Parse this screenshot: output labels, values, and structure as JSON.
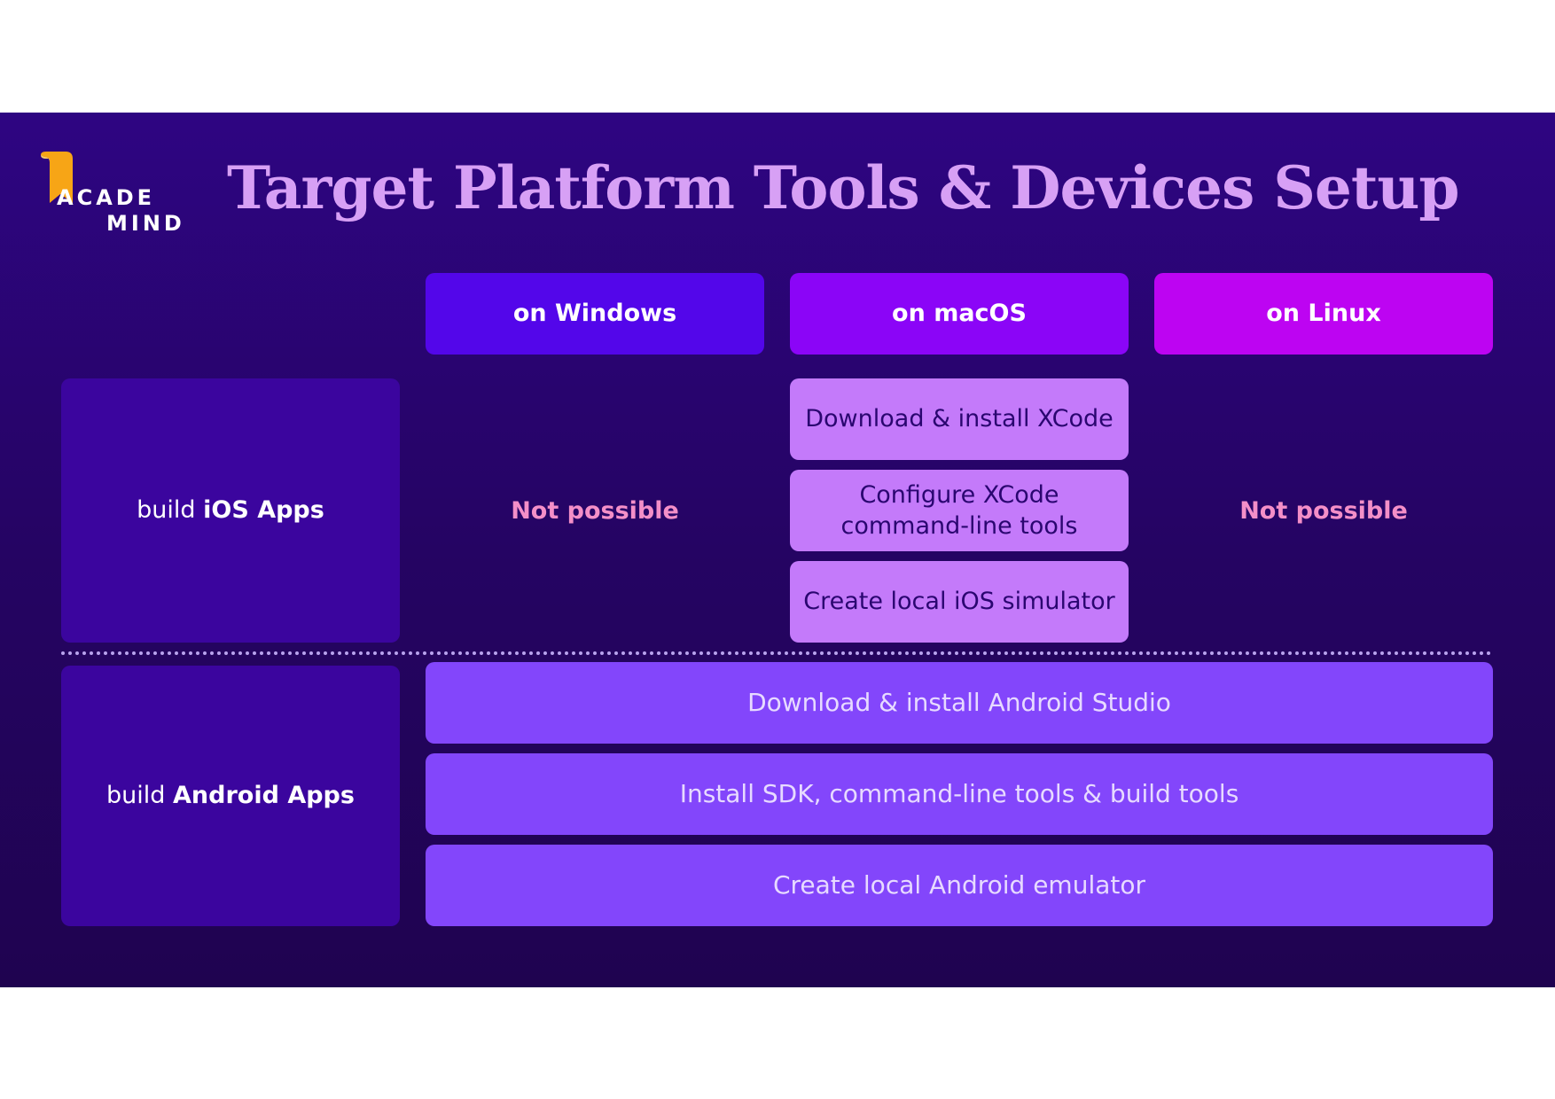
{
  "logo": {
    "line1": "ACADE",
    "line2": "MIND",
    "colors": {
      "mark": "#f7a516",
      "text": "#ffffff"
    }
  },
  "title": "Target Platform Tools & Devices Setup",
  "headers": {
    "windows": "on Windows",
    "macos": "on macOS",
    "linux": "on Linux"
  },
  "rows": {
    "ios": {
      "label_prefix": "build",
      "label_bold": "iOS Apps",
      "windows": "Not possible",
      "linux": "Not possible",
      "macos_steps": [
        "Download & install XCode",
        "Configure XCode command-line tools",
        "Create local iOS simulator"
      ]
    },
    "android": {
      "label_prefix": "build",
      "label_bold": "Android Apps",
      "steps": [
        "Download & install Android Studio",
        "Install SDK, command-line tools & build tools",
        "Create local Android emulator"
      ]
    }
  },
  "colors": {
    "background": "#250463",
    "title": "#d7a0f5",
    "windows_header": "#5306ea",
    "macos_header": "#8b05f7",
    "linux_header": "#bd04f2",
    "row_label": "#3b059e",
    "not_possible": "#f48fc8",
    "macos_step": "#c47afa",
    "android_step": "#8346fb"
  }
}
